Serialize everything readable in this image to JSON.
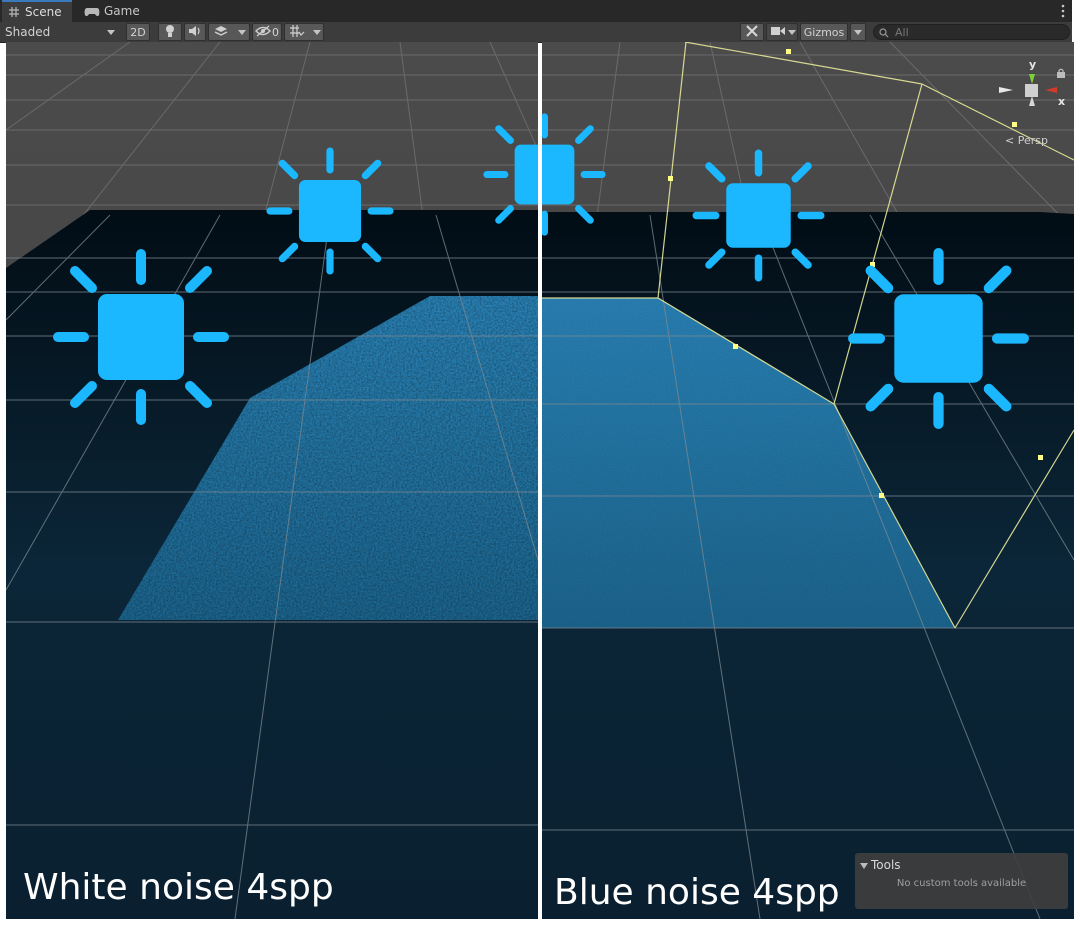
{
  "tabs": [
    {
      "label": "Scene",
      "icon": "grid-icon",
      "active": true
    },
    {
      "label": "Game",
      "icon": "gamepad-icon",
      "active": false
    }
  ],
  "toolbar": {
    "draw_mode": "Shaded",
    "mode_2d": "2D",
    "hidden_count": "0",
    "gizmos_label": "Gizmos",
    "search_placeholder": "All"
  },
  "gizmo": {
    "y_label": "y",
    "x_label": "x",
    "projection_label": "< Persp"
  },
  "left_panel": {
    "caption": "White noise 4spp"
  },
  "right_panel": {
    "caption": "Blue noise 4spp"
  },
  "tools_overlay": {
    "title": "Tools",
    "message": "No custom tools available"
  },
  "icons": [
    "lightbulb-icon",
    "audio-icon",
    "effects-icon",
    "visibility-icon",
    "grid-snap-icon",
    "tools-icon",
    "camera-icon",
    "search-icon",
    "more-icon",
    "lock-icon",
    "sun-icon"
  ],
  "colors": {
    "light_icon": "#1bb8ff",
    "grid_line": "#9aa3a8",
    "selection_outline": "#e8e89a",
    "floor_dark": "#04111a"
  }
}
